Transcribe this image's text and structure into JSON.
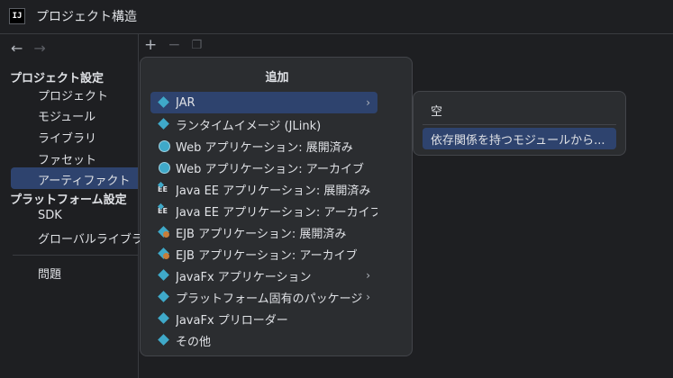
{
  "window": {
    "title": "プロジェクト構造",
    "app_icon_text": "IJ"
  },
  "nav": {
    "back_glyph": "←",
    "forward_glyph": "→"
  },
  "toolbar": {
    "add_glyph": "+",
    "remove_glyph": "−",
    "copy_glyph": "❐"
  },
  "sidebar": {
    "section_project": "プロジェクト設定",
    "project_items": [
      "プロジェクト",
      "モジュール",
      "ライブラリ",
      "ファセット",
      "アーティファクト"
    ],
    "section_platform": "プラットフォーム設定",
    "platform_items": [
      "SDK",
      "グローバルライブラ"
    ],
    "problems": "問題",
    "selected": "アーティファクト"
  },
  "popup": {
    "title": "追加",
    "items": [
      {
        "label": "JAR",
        "icon": "diamond-icon",
        "has_submenu": true,
        "highlighted": true
      },
      {
        "label": "ランタイムイメージ (JLink)",
        "icon": "diamond-icon",
        "has_submenu": false
      },
      {
        "label": "Web アプリケーション: 展開済み",
        "icon": "globe-icon",
        "has_submenu": false
      },
      {
        "label": "Web アプリケーション: アーカイブ",
        "icon": "globe-icon",
        "has_submenu": false
      },
      {
        "label": "Java EE アプリケーション: 展開済み",
        "icon": "java-ee-icon",
        "has_submenu": false
      },
      {
        "label": "Java EE アプリケーション: アーカイブ",
        "icon": "java-ee-icon",
        "has_submenu": false
      },
      {
        "label": "EJB アプリケーション: 展開済み",
        "icon": "ejb-bean-icon",
        "has_submenu": false
      },
      {
        "label": "EJB アプリケーション: アーカイブ",
        "icon": "ejb-bean-icon",
        "has_submenu": false
      },
      {
        "label": "JavaFx アプリケーション",
        "icon": "diamond-icon",
        "has_submenu": true
      },
      {
        "label": "プラットフォーム固有のパッケージ",
        "icon": "diamond-icon",
        "has_submenu": true
      },
      {
        "label": "JavaFx プリローダー",
        "icon": "diamond-icon",
        "has_submenu": false
      },
      {
        "label": "その他",
        "icon": "diamond-icon",
        "has_submenu": false
      }
    ],
    "chevron_glyph": "›"
  },
  "submenu": {
    "items": [
      "空",
      "依存関係を持つモジュールから..."
    ],
    "highlighted": "依存関係を持つモジュールから..."
  },
  "colors": {
    "background": "#1e1f22",
    "popup": "#2b2d30",
    "selection": "#2e436e",
    "icon_accent": "#3fa9c9"
  }
}
